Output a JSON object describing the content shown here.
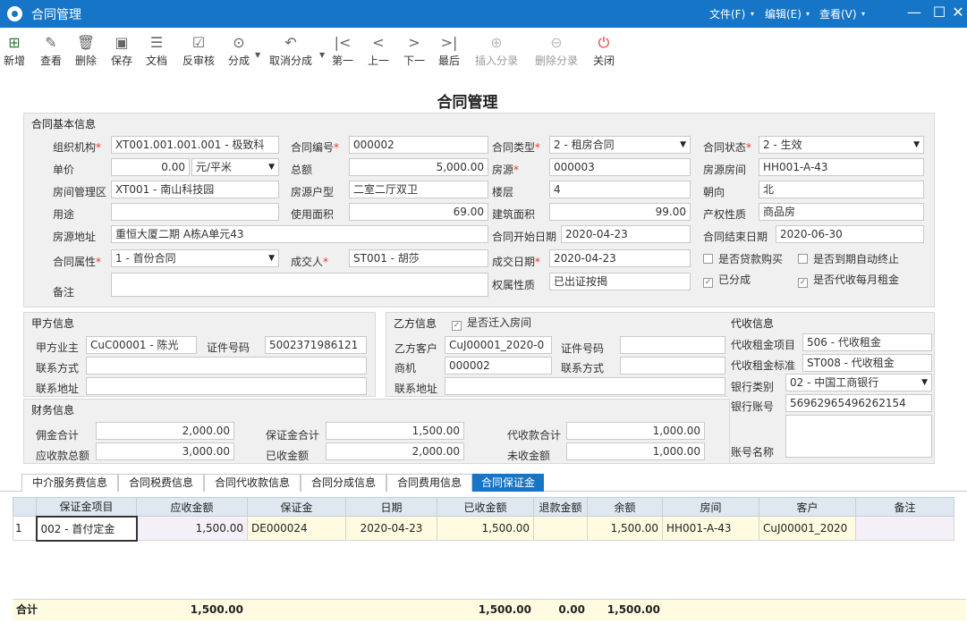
{
  "app": {
    "title": "合同管理"
  },
  "menus": [
    "文件(F)",
    "编辑(E)",
    "查看(V)"
  ],
  "toolbar": {
    "new": "新增",
    "view": "查看",
    "delete": "删除",
    "save": "保存",
    "doc": "文档",
    "unaudit": "反审核",
    "split": "分成",
    "cancel_split": "取消分成",
    "first": "第一",
    "prev": "上一",
    "next": "下一",
    "last": "最后",
    "insert_entry": "插入分录",
    "delete_entry": "删除分录",
    "close": "关闭"
  },
  "form": {
    "title": "合同管理",
    "basic": {
      "section": "合同基本信息",
      "org_label": "组织机构",
      "org": "XT001.001.001.001 - 极致科",
      "contract_no_label": "合同编号",
      "contract_no": "000002",
      "contract_type_label": "合同类型",
      "contract_type": "2 - 租房合同",
      "status_label": "合同状态",
      "status": "2 - 生效",
      "price_label": "单价",
      "price": "0.00",
      "price_unit": "元/平米",
      "total_label": "总额",
      "total": "5,000.00",
      "source_label": "房源",
      "source": "000003",
      "room_label": "房源房间",
      "room": "HH001-A-43",
      "zone_label": "房间管理区",
      "zone": "XT001 - 南山科技园",
      "layout_label": "房源户型",
      "layout": "二室二厅双卫",
      "floor_label": "楼层",
      "floor": "4",
      "orientation_label": "朝向",
      "orientation": "北",
      "usage_label": "用途",
      "usage": "",
      "usable_area_label": "使用面积",
      "usable_area": "69.00",
      "build_area_label": "建筑面积",
      "build_area": "99.00",
      "property_label": "产权性质",
      "property": "商品房",
      "address_label": "房源地址",
      "address": "重恒大厦二期 A栋A单元43",
      "start_label": "合同开始日期",
      "start": "2020-04-23",
      "end_label": "合同结束日期",
      "end": "2020-06-30",
      "attr_label": "合同属性",
      "attr": "1 - 首份合同",
      "dealer_label": "成交人",
      "dealer": "ST001 - 胡莎",
      "deal_date_label": "成交日期",
      "deal_date": "2020-04-23",
      "loan_label": "是否贷款购买",
      "auto_end_label": "是否到期自动终止",
      "remark_label": "备注",
      "remark": "",
      "right_label": "权属性质",
      "right": "已出证按揭",
      "split_label": "已分成",
      "monthly_rent_label": "是否代收每月租金"
    },
    "party_a": {
      "section": "甲方信息",
      "owner_label": "甲方业主",
      "owner": "CuC00001 - 陈光",
      "id_label": "证件号码",
      "id": "5002371986121",
      "contact_label": "联系方式",
      "contact": "",
      "addr_label": "联系地址",
      "addr": ""
    },
    "party_b": {
      "section": "乙方信息",
      "moved_label": "是否迁入房间",
      "customer_label": "乙方客户",
      "customer": "CuJ00001_2020-0",
      "id_label": "证件号码",
      "id": "",
      "opp_label": "商机",
      "opp": "000002",
      "contact_label": "联系方式",
      "contact": "",
      "addr_label": "联系地址",
      "addr": ""
    },
    "collect": {
      "section": "代收信息",
      "item_label": "代收租金项目",
      "item": "506 - 代收租金",
      "std_label": "代收租金标准",
      "std": "ST008 - 代收租金",
      "bank_type_label": "银行类别",
      "bank_type": "02 - 中国工商银行",
      "bank_acc_label": "银行账号",
      "bank_acc": "56962965496262154",
      "acc_name_label": "账号名称",
      "acc_name": ""
    },
    "finance": {
      "section": "财务信息",
      "commission_label": "佣金合计",
      "commission": "2,000.00",
      "deposit_label": "保证金合计",
      "deposit": "1,500.00",
      "collect_total_label": "代收款合计",
      "collect_total": "1,000.00",
      "receivable_label": "应收款总额",
      "receivable": "3,000.00",
      "received_label": "已收金额",
      "received": "2,000.00",
      "unreceived_label": "未收金额",
      "unreceived": "1,000.00"
    }
  },
  "tabs": [
    "中介服务费信息",
    "合同税费信息",
    "合同代收款信息",
    "合同分成信息",
    "合同费用信息",
    "合同保证金"
  ],
  "grid": {
    "columns": [
      "保证金项目",
      "应收金额",
      "保证金",
      "日期",
      "已收金额",
      "退款金额",
      "余额",
      "房间",
      "客户",
      "备注"
    ],
    "rows": [
      {
        "no": "1",
        "item": "002 - 首付定金",
        "receivable": "1,500.00",
        "deposit": "DE000024",
        "date": "2020-04-23",
        "received": "1,500.00",
        "refund": "",
        "balance": "1,500.00",
        "room": "HH001-A-43",
        "customer": "CuJ00001_2020",
        "remark": ""
      }
    ],
    "totals": {
      "label": "合计",
      "receivable": "1,500.00",
      "received": "1,500.00",
      "refund": "0.00",
      "balance": "1,500.00"
    }
  }
}
